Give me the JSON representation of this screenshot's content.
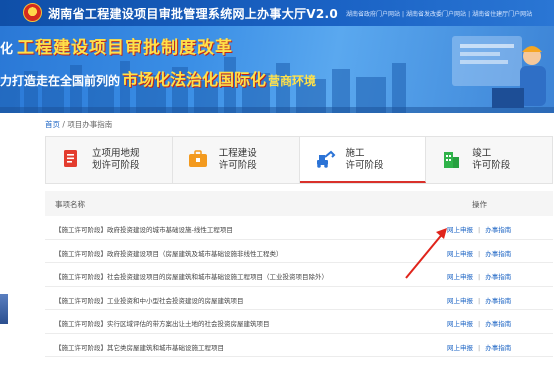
{
  "header": {
    "title": "湖南省工程建设项目审批管理系统网上办事大厅V2.0",
    "links": [
      "湖南省政府门户网站",
      "湖南省发改委门户网站",
      "湖南省住建厅门户网站"
    ]
  },
  "banner": {
    "line1_prefix": "化",
    "line1_main": "工程建设项目审批制度改革",
    "line2_prefix": "力打造走在全国前列的",
    "line2_highlight": "市场化法治化国际化",
    "line2_tail": "营商环境"
  },
  "breadcrumb": {
    "home": "首页",
    "separator": "/",
    "current": "项目办事指南"
  },
  "stages": [
    {
      "label": "立项用地规\n划许可阶段",
      "icon": "document-red-icon",
      "active": false
    },
    {
      "label": "工程建设\n许可阶段",
      "icon": "briefcase-orange-icon",
      "active": false
    },
    {
      "label": "施工\n许可阶段",
      "icon": "excavator-blue-icon",
      "active": true
    },
    {
      "label": "竣工\n许可阶段",
      "icon": "building-green-icon",
      "active": false
    }
  ],
  "table": {
    "col_name": "事项名称",
    "col_ops": "操作",
    "rows": [
      "【施工许可阶段】政府投资建设的城市基础设施-线性工程项目",
      "【施工许可阶段】政府投资建设项目（房屋建筑及城市基础设施非线性工程类）",
      "【施工许可阶段】社会投资建设项目的房屋建筑和城市基础设施工程项目（工业投资项目除外）",
      "【施工许可阶段】工业投资和中小型社会投资建设的房屋建筑项目",
      "【施工许可阶段】实行区域评估的带方案出让土地的社会投资房屋建筑项目",
      "【施工许可阶段】其它类房屋建筑和城市基础设施工程项目"
    ],
    "op_apply": "网上申报",
    "op_sep": "|",
    "op_guide": "办事指南"
  },
  "colors": {
    "header_blue": "#1a62c4",
    "active_red": "#d9302a",
    "link_blue": "#1c64c4",
    "arrow_red": "#e0241b"
  }
}
